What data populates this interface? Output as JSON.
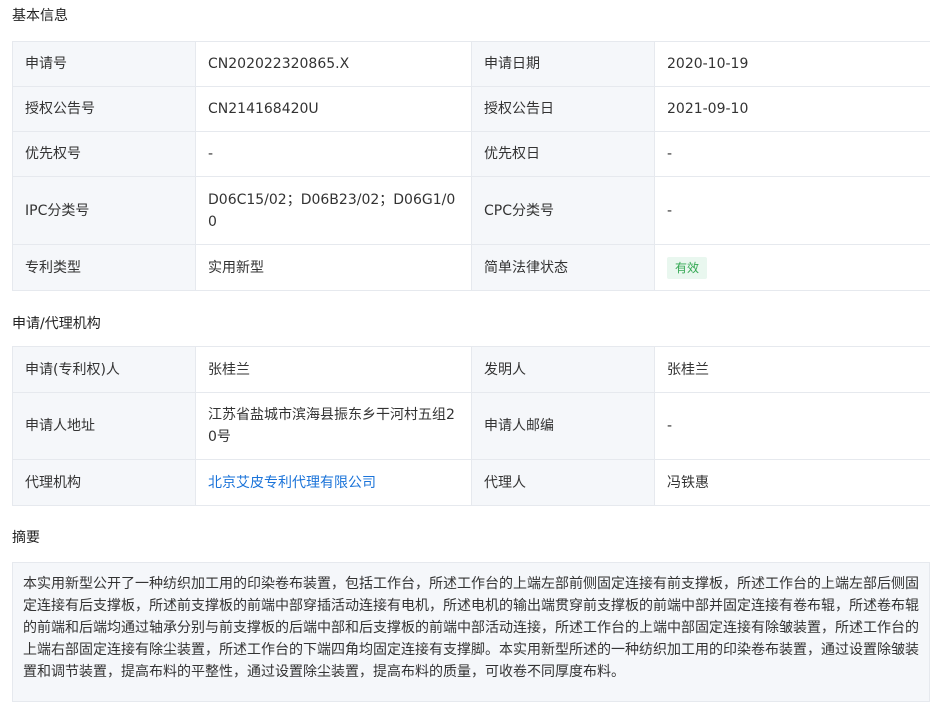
{
  "basic": {
    "title": "基本信息",
    "rows": [
      {
        "l1": "申请号",
        "v1": "CN202022320865.X",
        "l2": "申请日期",
        "v2": "2020-10-19"
      },
      {
        "l1": "授权公告号",
        "v1": "CN214168420U",
        "l2": "授权公告日",
        "v2": "2021-09-10"
      },
      {
        "l1": "优先权号",
        "v1": "-",
        "l2": "优先权日",
        "v2": "-"
      },
      {
        "l1": "IPC分类号",
        "v1": "D06C15/02；D06B23/02；D06G1/00",
        "l2": "CPC分类号",
        "v2": "-"
      },
      {
        "l1": "专利类型",
        "v1": "实用新型",
        "l2": "简单法律状态",
        "v2": "有效"
      }
    ]
  },
  "agency": {
    "title": "申请/代理机构",
    "rows": [
      {
        "l1": "申请(专利权)人",
        "v1": "张桂兰",
        "l2": "发明人",
        "v2": "张桂兰"
      },
      {
        "l1": "申请人地址",
        "v1": "江苏省盐城市滨海县振东乡干河村五组20号",
        "l2": "申请人邮编",
        "v2": "-"
      },
      {
        "l1": "代理机构",
        "v1": "北京艾皮专利代理有限公司",
        "l2": "代理人",
        "v2": "冯铁惠"
      }
    ]
  },
  "abstract": {
    "title": "摘要",
    "text": "本实用新型公开了一种纺织加工用的印染卷布装置，包括工作台，所述工作台的上端左部前侧固定连接有前支撑板，所述工作台的上端左部后侧固定连接有后支撑板，所述前支撑板的前端中部穿插活动连接有电机，所述电机的输出端贯穿前支撑板的前端中部并固定连接有卷布辊，所述卷布辊的前端和后端均通过轴承分别与前支撑板的后端中部和后支撑板的前端中部活动连接，所述工作台的上端中部固定连接有除皱装置，所述工作台的上端右部固定连接有除尘装置，所述工作台的下端四角均固定连接有支撑脚。本实用新型所述的一种纺织加工用的印染卷布装置，通过设置除皱装置和调节装置，提高布料的平整性，通过设置除尘装置，提高布料的质量，可收卷不同厚度布料。"
  },
  "colors": {
    "label_bg": "#f5f7fa",
    "border": "#e6e9ee",
    "link": "#1a73d9",
    "badge_bg": "#e9f7ef",
    "badge_fg": "#34a853"
  }
}
